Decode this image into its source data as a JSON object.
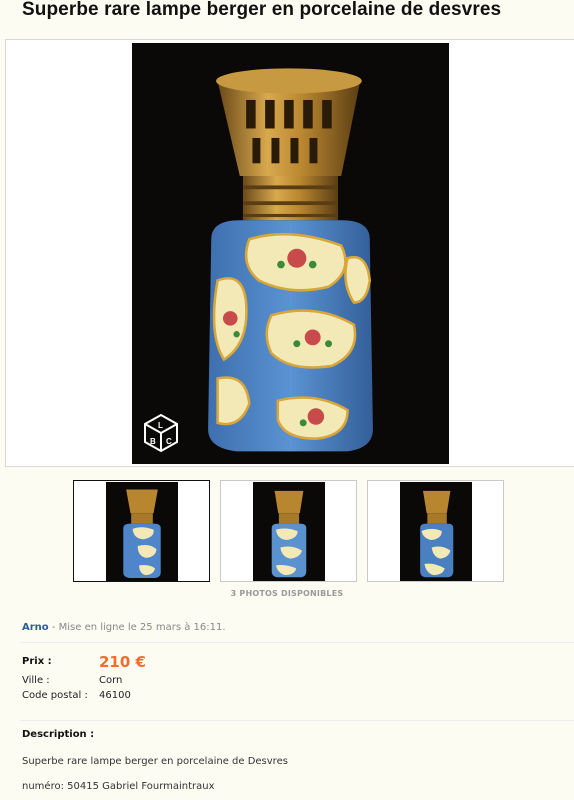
{
  "ad": {
    "title": "Superbe rare lampe berger en porcelaine de desvres",
    "photos_count_label": "3 PHOTOS DISPONIBLES"
  },
  "watermark": {
    "icon": "lbc-cube-logo-icon",
    "letters": [
      "L",
      "B",
      "C"
    ]
  },
  "thumbnails": [
    {
      "alt": "photo-1",
      "selected": true
    },
    {
      "alt": "photo-2",
      "selected": false
    },
    {
      "alt": "photo-3",
      "selected": false
    }
  ],
  "seller": {
    "name": "Arno",
    "posted": " - Mise en ligne le 25 mars à 16:11."
  },
  "details": {
    "price_label": "Prix :",
    "price_value": "210 €",
    "city_label": "Ville :",
    "city_value": "Corn",
    "postal_label": "Code postal :",
    "postal_value": "46100"
  },
  "description": {
    "title": "Description :",
    "lines": [
      "Superbe rare lampe berger en porcelaine de Desvres",
      "numéro: 50415 Gabriel Fourmaintraux"
    ]
  },
  "colors": {
    "price": "#f56b2a",
    "seller_link": "#2b5c99",
    "porcelain_blue": "#4f86c9",
    "brass": "#b8862f"
  }
}
